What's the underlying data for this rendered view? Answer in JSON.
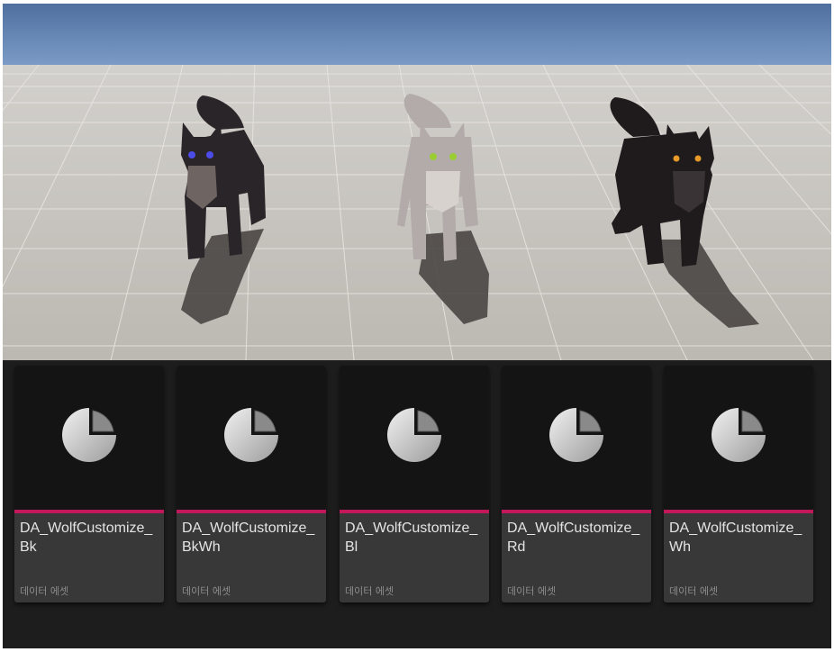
{
  "viewport": {
    "sky_color": "#6a8ab6",
    "floor_color": "#c9c6c1",
    "wolves": [
      {
        "name": "black wolf with blue eyes",
        "fur": "#2a2528",
        "chest": "#6e6462",
        "eyes": "#4c4ce8"
      },
      {
        "name": "white wolf with green eyes",
        "fur": "#b3aaaa",
        "chest": "#d8d2cf",
        "eyes": "#9acd32"
      },
      {
        "name": "black wolf with amber eyes",
        "fur": "#1f1b1d",
        "chest": "#3a3335",
        "eyes": "#e79a2a"
      }
    ]
  },
  "asset_browser": {
    "accent_color": "#c2185b",
    "icon": "data-asset-pie-icon",
    "assets": [
      {
        "name": "DA_WolfCustomize_Bk",
        "type": "데이터 에셋"
      },
      {
        "name": "DA_WolfCustomize_BkWh",
        "type": "데이터 에셋"
      },
      {
        "name": "DA_WolfCustomize_Bl",
        "type": "데이터 에셋"
      },
      {
        "name": "DA_WolfCustomize_Rd",
        "type": "데이터 에셋"
      },
      {
        "name": "DA_WolfCustomize_Wh",
        "type": "데이터 에셋"
      }
    ]
  }
}
